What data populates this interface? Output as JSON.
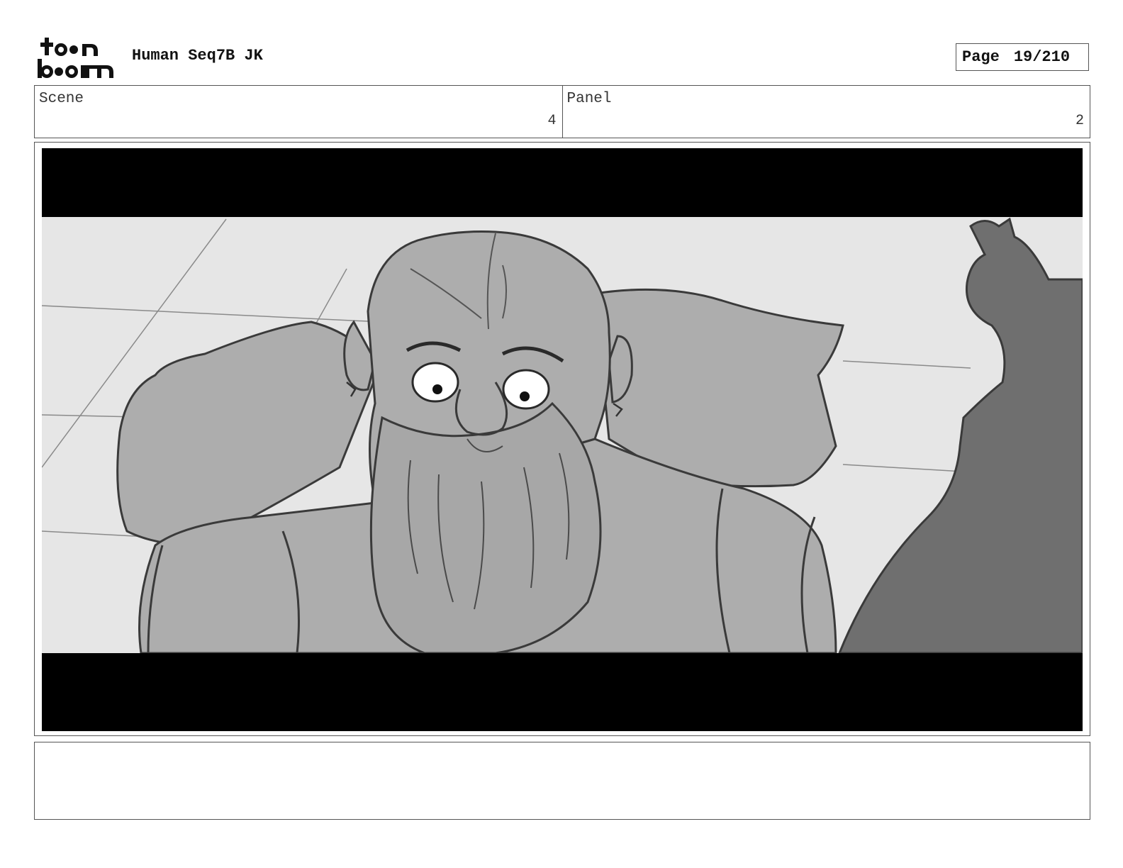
{
  "header": {
    "logo_text": "toon boom",
    "title": "Human Seq7B JK",
    "page_label": "Page",
    "page_value": "19/210"
  },
  "scene": {
    "label": "Scene",
    "value": "4"
  },
  "panel": {
    "label": "Panel",
    "value": "2"
  },
  "artwork": {
    "subject": "dwarf-sketch-icon"
  },
  "notes": {
    "text": ""
  }
}
